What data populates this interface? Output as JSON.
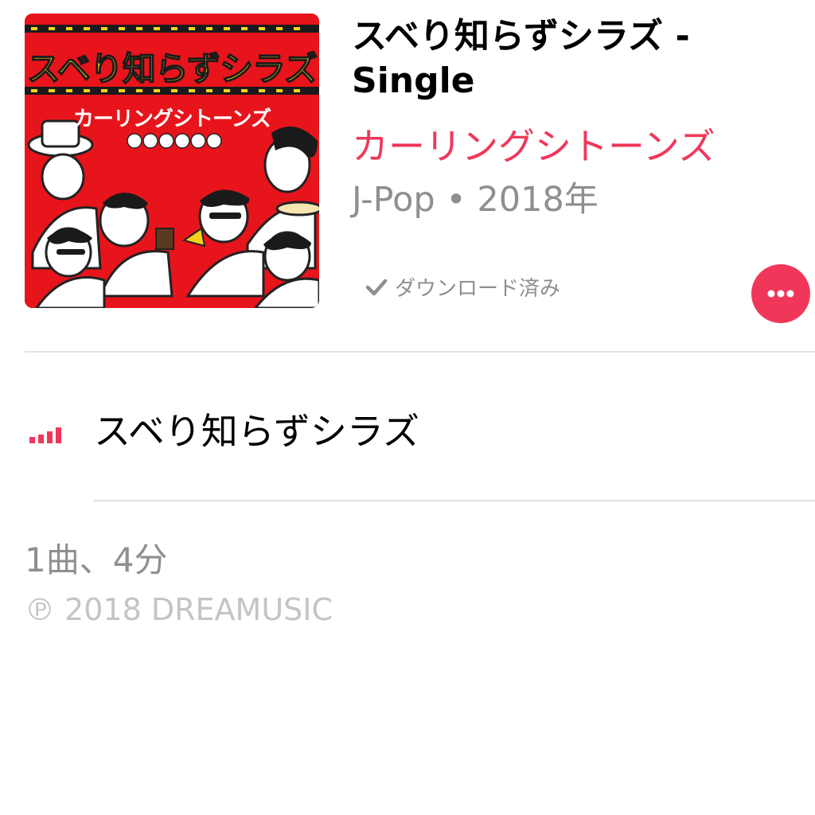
{
  "album": {
    "title": "スベり知らずシラズ - Single",
    "artist": "カーリングシトーンズ",
    "genre_year": "J-Pop • 2018年",
    "download_status": "ダウンロード済み",
    "artwork": {
      "title_text": "スベり知らずシラズ",
      "subtitle_text": "カーリングシトーンズ",
      "background_color": "#e8141c"
    }
  },
  "tracks": [
    {
      "title": "スベり知らずシラズ",
      "now_playing": true
    }
  ],
  "summary": {
    "count_duration": "1曲、4分",
    "copyright": "℗ 2018 DREAMUSIC"
  },
  "colors": {
    "accent": "#f0375a",
    "secondary_text": "#8e8e93",
    "tertiary_text": "#c4c4c8",
    "divider": "#e2e2e4"
  },
  "icons": {
    "check": "check-icon",
    "more": "more-ellipsis-icon",
    "now_playing": "equalizer-icon"
  }
}
